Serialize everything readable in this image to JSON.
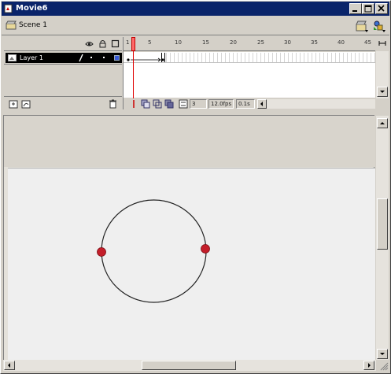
{
  "window": {
    "title": "Movie6"
  },
  "scene": {
    "label": "Scene 1"
  },
  "timeline": {
    "layer_name": "Layer 1",
    "ruler_ticks": [
      "1",
      "5",
      "10",
      "15",
      "20",
      "25",
      "30",
      "35",
      "40",
      "45"
    ],
    "current_frame": "3",
    "frame_rate": "12.0fps",
    "elapsed_time": "0.1s"
  },
  "colors": {
    "titlebar": "#0a246a",
    "layer_selected": "#000000",
    "playhead": "#ff6a6a",
    "dot": "#c41e2a"
  },
  "icons": {
    "app": "flash-document-icon",
    "scene": "clapper-icon",
    "edit_scene": "edit-scene-icon",
    "edit_symbol": "edit-symbol-icon"
  }
}
